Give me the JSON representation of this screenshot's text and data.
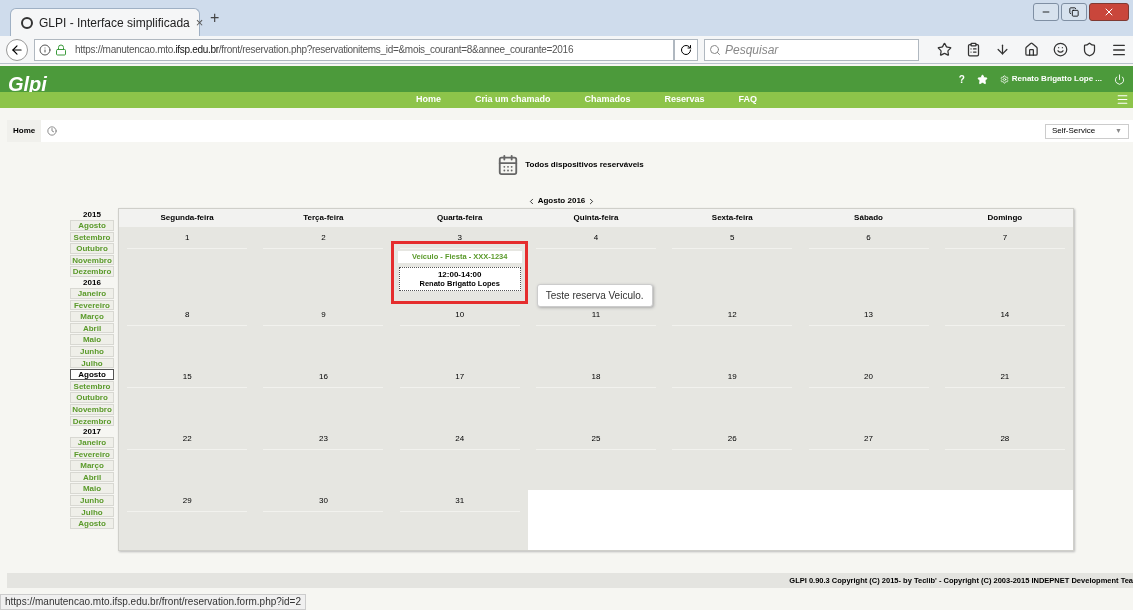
{
  "browser": {
    "tab": {
      "title": "GLPI - Interface simplificada",
      "close": "×",
      "selected": true
    },
    "new_tab": "+",
    "url_prefix": "https://manutencao.mto.",
    "url_domain": "ifsp.edu.br",
    "url_rest": "/front/reservation.php?reservationitems_id=&mois_courant=8&annee_courante=2016",
    "search": {
      "placeholder": "Pesquisar"
    }
  },
  "app": {
    "logo": "Glpi",
    "help": "?",
    "user": "Renato Brigatto Lope ...",
    "menu": [
      {
        "label": "Home",
        "selected": false
      },
      {
        "label": "Cria um chamado",
        "selected": false
      },
      {
        "label": "Chamados",
        "selected": false
      },
      {
        "label": "Reservas",
        "selected": false
      },
      {
        "label": "FAQ",
        "selected": false
      }
    ],
    "breadcrumb": "Home",
    "profile": {
      "value": "Self-Service",
      "caret": "▼"
    }
  },
  "page": {
    "title": "Todos dispositivos reserváveis",
    "month_title": "Agosto 2016"
  },
  "month_nav": [
    {
      "year": "2015",
      "months": [
        {
          "label": "Agosto",
          "selected": false
        },
        {
          "label": "Setembro",
          "selected": false
        },
        {
          "label": "Outubro",
          "selected": false
        },
        {
          "label": "Novembro",
          "selected": false
        },
        {
          "label": "Dezembro",
          "selected": false
        }
      ]
    },
    {
      "year": "2016",
      "months": [
        {
          "label": "Janeiro",
          "selected": false
        },
        {
          "label": "Fevereiro",
          "selected": false
        },
        {
          "label": "Março",
          "selected": false
        },
        {
          "label": "Abril",
          "selected": false
        },
        {
          "label": "Maio",
          "selected": false
        },
        {
          "label": "Junho",
          "selected": false
        },
        {
          "label": "Julho",
          "selected": false
        },
        {
          "label": "Agosto",
          "selected": true
        },
        {
          "label": "Setembro",
          "selected": false
        },
        {
          "label": "Outubro",
          "selected": false
        },
        {
          "label": "Novembro",
          "selected": false
        },
        {
          "label": "Dezembro",
          "selected": false
        }
      ]
    },
    {
      "year": "2017",
      "months": [
        {
          "label": "Janeiro",
          "selected": false
        },
        {
          "label": "Fevereiro",
          "selected": false
        },
        {
          "label": "Março",
          "selected": false
        },
        {
          "label": "Abril",
          "selected": false
        },
        {
          "label": "Maio",
          "selected": false
        },
        {
          "label": "Junho",
          "selected": false
        },
        {
          "label": "Julho",
          "selected": false
        },
        {
          "label": "Agosto",
          "selected": false
        }
      ]
    }
  ],
  "calendar": {
    "weekdays": [
      "Segunda-feira",
      "Terça-feira",
      "Quarta-feira",
      "Quinta-feira",
      "Sexta-feira",
      "Sábado",
      "Domingo"
    ],
    "weeks": [
      [
        {
          "date": "1"
        },
        {
          "date": "2"
        },
        {
          "date": "3",
          "events": [
            {
              "item": "Veículo - Fiesta - XXX-1234",
              "time": "12:00-14:00",
              "user": "Renato Brigatto Lopes",
              "tooltip": "Teste reserva Veiculo.",
              "highlighted": true
            }
          ]
        },
        {
          "date": "4"
        },
        {
          "date": "5"
        },
        {
          "date": "6"
        },
        {
          "date": "7"
        }
      ],
      [
        {
          "date": "8"
        },
        {
          "date": "9"
        },
        {
          "date": "10"
        },
        {
          "date": "11"
        },
        {
          "date": "12"
        },
        {
          "date": "13"
        },
        {
          "date": "14"
        }
      ],
      [
        {
          "date": "15"
        },
        {
          "date": "16"
        },
        {
          "date": "17"
        },
        {
          "date": "18"
        },
        {
          "date": "19"
        },
        {
          "date": "20"
        },
        {
          "date": "21"
        }
      ],
      [
        {
          "date": "22"
        },
        {
          "date": "23"
        },
        {
          "date": "24"
        },
        {
          "date": "25"
        },
        {
          "date": "26"
        },
        {
          "date": "27"
        },
        {
          "date": "28"
        }
      ],
      [
        {
          "date": "29"
        },
        {
          "date": "30"
        },
        {
          "date": "31"
        }
      ]
    ]
  },
  "footer": "GLPI 0.90.3 Copyright (C) 2015- by Teclib' - Copyright (C) 2003-2015 INDEPNET Development Tea",
  "status_bar": "https://manutencao.mto.ifsp.edu.br/front/reservation.form.php?id=2"
}
